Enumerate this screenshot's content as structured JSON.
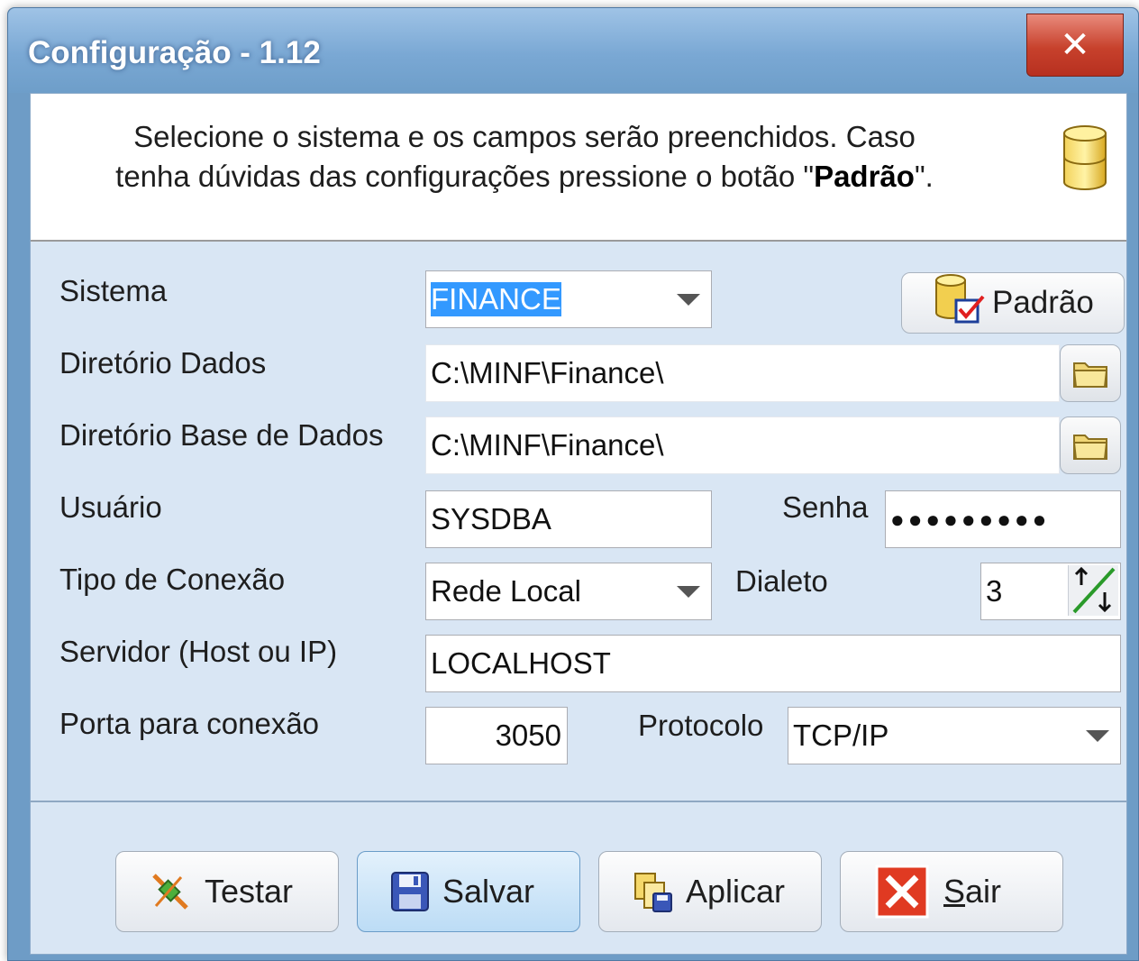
{
  "window": {
    "title": "Configuração - 1.12",
    "close_label": "✕"
  },
  "header": {
    "line1": "Selecione o sistema e os campos serão preenchidos. Caso",
    "line2_prefix": "tenha dúvidas das configurações pressione o botão \"",
    "line2_bold": "Padrão",
    "line2_suffix": "\"."
  },
  "form": {
    "sistema": {
      "label": "Sistema",
      "value": "FINANCE"
    },
    "padrao_button": "Padrão",
    "diretorio_dados": {
      "label": "Diretório Dados",
      "value": "C:\\MINF\\Finance\\"
    },
    "diretorio_base": {
      "label": "Diretório Base de Dados",
      "value": "C:\\MINF\\Finance\\"
    },
    "usuario": {
      "label": "Usuário",
      "value": "SYSDBA"
    },
    "senha": {
      "label": "Senha",
      "value": "●●●●●●●●●"
    },
    "tipo_conexao": {
      "label": "Tipo de Conexão",
      "value": "Rede Local"
    },
    "dialeto": {
      "label": "Dialeto",
      "value": "3"
    },
    "servidor": {
      "label": "Servidor (Host ou IP)",
      "value": "LOCALHOST"
    },
    "porta": {
      "label": "Porta para conexão",
      "value": "3050"
    },
    "protocolo": {
      "label": "Protocolo",
      "value": "TCP/IP"
    }
  },
  "buttons": {
    "testar": "Testar",
    "salvar": "Salvar",
    "aplicar": "Aplicar",
    "sair_first": "S",
    "sair_rest": "air"
  },
  "icons": {
    "header": "database-icon",
    "padrao": "database-check-icon",
    "folder": "folder-icon",
    "spin": "spin-arrows-icon",
    "testar": "plug-icon",
    "salvar": "floppy-disk-icon",
    "aplicar": "apply-copy-icon",
    "sair": "red-x-icon"
  },
  "colors": {
    "title_bar": "#7aa8d4",
    "client_bg": "#d9e6f4",
    "close_button": "#c7412c",
    "selection": "#3399ff"
  }
}
